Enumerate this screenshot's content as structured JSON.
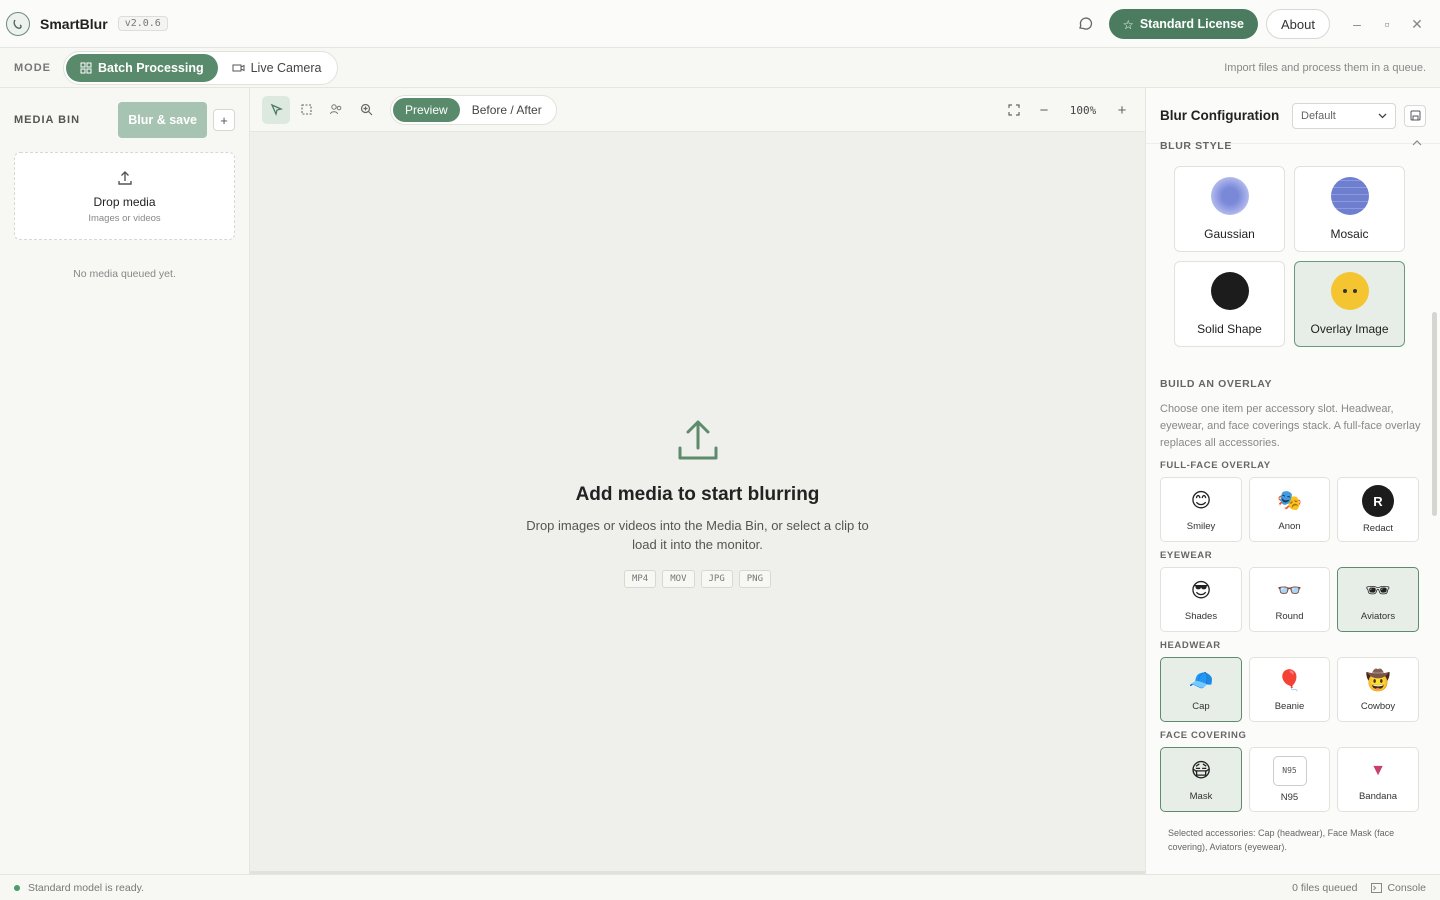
{
  "app": {
    "name": "SmartBlur",
    "version": "v2.0.6"
  },
  "titlebar": {
    "license_label": "Standard License",
    "about_label": "About",
    "minimize": "–",
    "maximize": "▫",
    "close": "✕"
  },
  "mode": {
    "label": "MODE",
    "options": [
      {
        "label": "Batch Processing",
        "active": true
      },
      {
        "label": "Live Camera",
        "active": false
      }
    ],
    "hint": "Import files and process them in a queue."
  },
  "media_bin": {
    "title": "MEDIA BIN",
    "blur_save_label": "Blur & save",
    "add_label": "+",
    "drop_title": "Drop media",
    "drop_sub": "Images or videos",
    "empty_note": "No media queued yet."
  },
  "viewer": {
    "views": [
      {
        "label": "Preview",
        "active": true
      },
      {
        "label": "Before / After",
        "active": false
      }
    ],
    "zoom": "100%",
    "empty_title": "Add media to start blurring",
    "empty_desc": "Drop images or videos into the Media Bin, or select a clip to load it into the monitor.",
    "formats": [
      "MP4",
      "MOV",
      "JPG",
      "PNG"
    ]
  },
  "config": {
    "title": "Blur Configuration",
    "preset": "Default",
    "blur_style_label": "BLUR STYLE",
    "styles": [
      {
        "label": "Gaussian",
        "selected": false
      },
      {
        "label": "Mosaic",
        "selected": false
      },
      {
        "label": "Solid Shape",
        "selected": false
      },
      {
        "label": "Overlay Image",
        "selected": true
      }
    ],
    "overlay_label": "BUILD AN OVERLAY",
    "overlay_desc": "Choose one item per accessory slot. Headwear, eyewear, and face coverings stack. A full-face overlay replaces all accessories.",
    "groups": [
      {
        "label": "FULL-FACE OVERLAY",
        "items": [
          {
            "label": "Smiley",
            "icon": "😊",
            "selected": false
          },
          {
            "label": "Anon",
            "icon": "🎭",
            "selected": false
          },
          {
            "label": "Redact",
            "icon": "R",
            "selected": false
          }
        ]
      },
      {
        "label": "EYEWEAR",
        "items": [
          {
            "label": "Shades",
            "icon": "😎",
            "selected": false
          },
          {
            "label": "Round",
            "icon": "👓",
            "selected": false
          },
          {
            "label": "Aviators",
            "icon": "🕶",
            "selected": true
          }
        ]
      },
      {
        "label": "HEADWEAR",
        "items": [
          {
            "label": "Cap",
            "icon": "🧢",
            "selected": true
          },
          {
            "label": "Beanie",
            "icon": "🎈",
            "selected": false
          },
          {
            "label": "Cowboy",
            "icon": "🤠",
            "selected": false
          }
        ]
      },
      {
        "label": "FACE COVERING",
        "items": [
          {
            "label": "Mask",
            "icon": "😷",
            "selected": true
          },
          {
            "label": "N95",
            "icon": "N95",
            "selected": false
          },
          {
            "label": "Bandana",
            "icon": "▼",
            "selected": false
          }
        ]
      }
    ],
    "summary": "Selected accessories: Cap (headwear), Face Mask (face covering), Aviators (eyewear)."
  },
  "status": {
    "message": "Standard model is ready.",
    "queue": "0 files queued",
    "console": "Console"
  }
}
